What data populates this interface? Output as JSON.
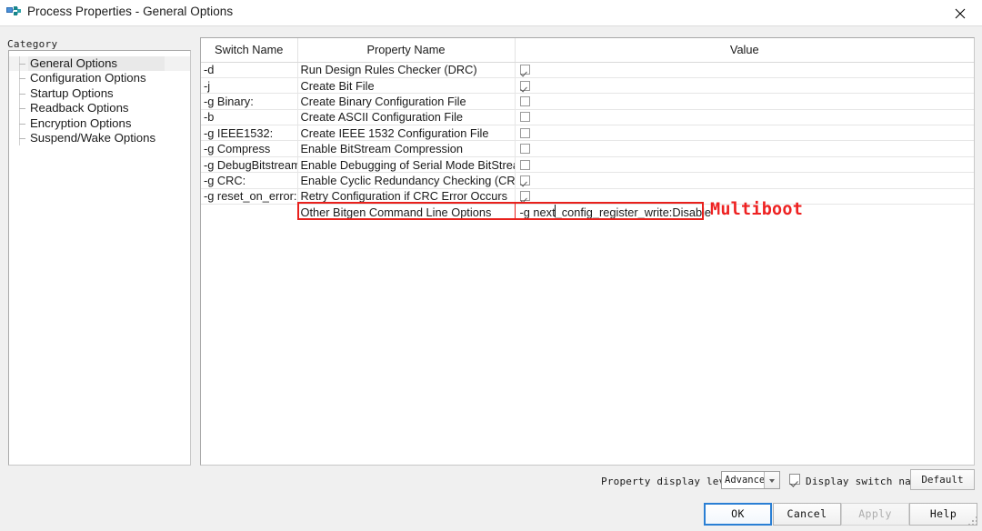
{
  "window": {
    "title": "Process Properties - General Options",
    "icon": "process-properties-icon",
    "close_label": "✕"
  },
  "sidebar": {
    "label": "Category",
    "items": [
      {
        "label": "General Options",
        "selected": true
      },
      {
        "label": "Configuration Options",
        "selected": false
      },
      {
        "label": "Startup Options",
        "selected": false
      },
      {
        "label": "Readback Options",
        "selected": false
      },
      {
        "label": "Encryption Options",
        "selected": false
      },
      {
        "label": "Suspend/Wake Options",
        "selected": false
      }
    ]
  },
  "grid": {
    "columns": [
      "Switch Name",
      "Property Name",
      "Value"
    ],
    "rows": [
      {
        "switch": "-d",
        "property": "Run Design Rules Checker (DRC)",
        "value_type": "checkbox",
        "checked": true,
        "value": ""
      },
      {
        "switch": "-j",
        "property": "Create Bit File",
        "value_type": "checkbox",
        "checked": true,
        "value": ""
      },
      {
        "switch": "-g Binary:",
        "property": "Create Binary Configuration File",
        "value_type": "checkbox",
        "checked": false,
        "value": ""
      },
      {
        "switch": "-b",
        "property": "Create ASCII Configuration File",
        "value_type": "checkbox",
        "checked": false,
        "value": ""
      },
      {
        "switch": "-g IEEE1532:",
        "property": "Create IEEE 1532 Configuration File",
        "value_type": "checkbox",
        "checked": false,
        "value": ""
      },
      {
        "switch": "-g Compress",
        "property": "Enable BitStream Compression",
        "value_type": "checkbox",
        "checked": false,
        "value": ""
      },
      {
        "switch": "-g DebugBitstream:",
        "property": "Enable Debugging of Serial Mode BitStream",
        "value_type": "checkbox",
        "checked": false,
        "value": ""
      },
      {
        "switch": "-g CRC:",
        "property": "Enable Cyclic Redundancy Checking (CRC)",
        "value_type": "checkbox",
        "checked": true,
        "value": ""
      },
      {
        "switch": "-g reset_on_error:",
        "property": "Retry Configuration if CRC Error Occurs",
        "value_type": "checkbox",
        "checked": true,
        "value": ""
      },
      {
        "switch": "",
        "property": "Other Bitgen Command Line Options",
        "value_type": "text",
        "checked": false,
        "value": "-g next_config_register_write:Disable"
      }
    ]
  },
  "annotation": {
    "text": "Multiboot",
    "color": "#ee2222",
    "highlight_color": "#e8201c"
  },
  "footer": {
    "display_level_label": "Property display level:",
    "display_level_value": "Advanced",
    "display_level_options": [
      "Advanced"
    ],
    "switch_names_label": "Display switch names",
    "switch_names_checked": true,
    "default_button": "Default"
  },
  "dialog_buttons": {
    "ok": "OK",
    "cancel": "Cancel",
    "apply": "Apply",
    "help": "Help"
  }
}
